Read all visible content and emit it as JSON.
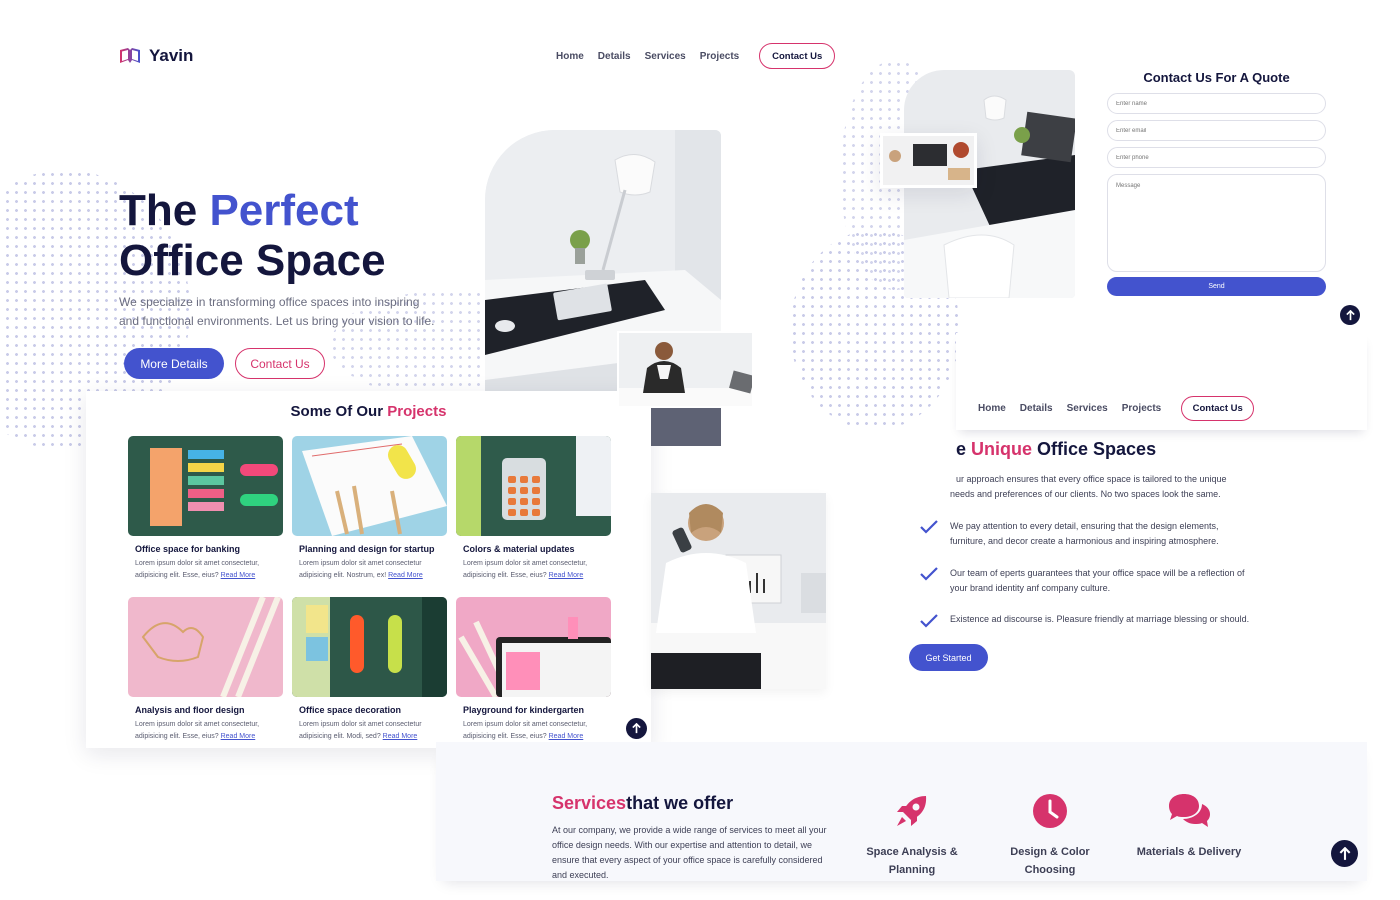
{
  "brand": {
    "name": "Yavin"
  },
  "nav": {
    "home": "Home",
    "details": "Details",
    "services": "Services",
    "projects": "Projects",
    "contact": "Contact Us"
  },
  "hero": {
    "title_part1": "The ",
    "title_accent": "Perfect",
    "title_line2": "Office Space",
    "text": "We specialize in transforming office spaces into inspiring and functional environments. Let us bring your vision to life.",
    "more_details": "More Details",
    "contact": "Contact Us"
  },
  "projects": {
    "title_prefix": "Some Of Our ",
    "title_accent": "Projects",
    "read_more": "Read More",
    "items": [
      {
        "title": "Office space for banking",
        "desc": "Lorem ipsum dolor sit amet consectetur, adipisicing elit. Esse, eius?"
      },
      {
        "title": "Planning and design for startup",
        "desc": "Lorem ipsum dolor sit amet consectetur adipisicing elit. Nostrum, ex!"
      },
      {
        "title": "Colors & material updates",
        "desc": "Lorem ipsum dolor sit amet consectetur, adipisicing elit. Esse, eius?"
      },
      {
        "title": "Analysis and floor design",
        "desc": "Lorem ipsum dolor sit amet consectetur, adipisicing elit. Esse, eius?"
      },
      {
        "title": "Office space decoration",
        "desc": "Lorem ipsum dolor sit amet consectetur adipisicing elit. Modi, sed?"
      },
      {
        "title": "Playground for kindergarten",
        "desc": "Lorem ipsum dolor sit amet consectetur, adipisicing elit. Esse, eius?"
      }
    ]
  },
  "quote": {
    "title": "Contact Us For A Quote",
    "name_placeholder": "Enter name",
    "email_placeholder": "Enter email",
    "phone_placeholder": "Enter phone",
    "message_placeholder": "Message",
    "send": "Send"
  },
  "unique": {
    "title_prefix": "e ",
    "title_accent": "Unique",
    "title_suffix": " Office Spaces",
    "intro": "ur approach ensures that every office space is tailored to the unique needs and preferences of our clients. No two spaces look the same.",
    "points": [
      "We pay attention to every detail, ensuring that the design elements, furniture, and decor create a harmonious and inspiring atmosphere.",
      "Our team of eperts guarantees that your office space will be a reflection of your brand identity anf company culture.",
      "Existence ad discourse is. Pleasure friendly at marriage blessing or should."
    ],
    "cta": "Get Started"
  },
  "services": {
    "title_accent": "Services",
    "title_rest": "that we offer",
    "text": "At our company, we provide a wide range of services to meet all your office design needs. With our expertise and attention to detail, we ensure that every aspect of your office space is carefully considered and executed.",
    "items": [
      {
        "label": "Space Analysis & Planning",
        "icon": "rocket-icon"
      },
      {
        "label": "Design & Color Choosing",
        "icon": "clock-icon"
      },
      {
        "label": "Materials & Delivery",
        "icon": "chat-bubbles-icon"
      }
    ]
  },
  "colors": {
    "primary": "#4353ce",
    "accent": "#d6336c",
    "dark": "#14163d"
  }
}
